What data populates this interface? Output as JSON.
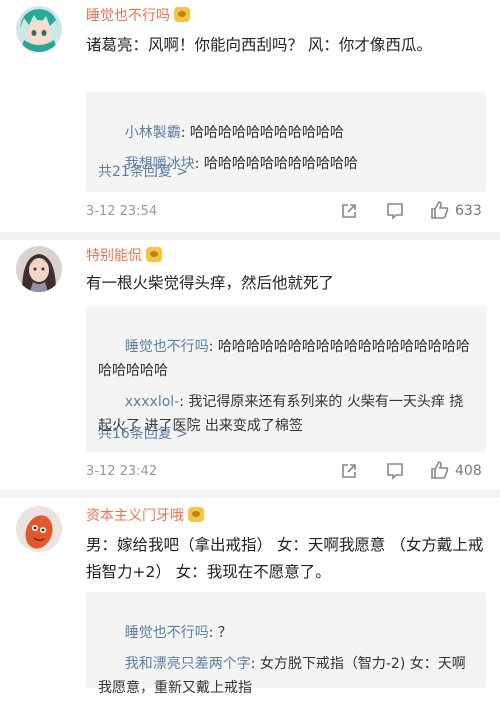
{
  "comments": [
    {
      "username": "睡觉也不行吗",
      "text": "诸葛亮：风啊！你能向西刮吗？ 风：你才像西瓜。",
      "replies": [
        {
          "name": "小林製霸",
          "text": "哈哈哈哈哈哈哈哈哈哈哈"
        },
        {
          "name": "我想嚼冰块",
          "text": "哈哈哈哈哈哈哈哈哈哈哈"
        }
      ],
      "more": "共21条回复 >",
      "time": "3-12 23:54",
      "likes": "633"
    },
    {
      "username": "特别能侃",
      "text": "有一根火柴觉得头痒，然后他就死了",
      "replies": [
        {
          "name": "睡觉也不行吗",
          "text": "哈哈哈哈哈哈哈哈哈哈哈哈哈哈哈哈哈哈哈哈哈哈哈"
        },
        {
          "name": "xxxxlol-",
          "text": "我记得原来还有系列来的 火柴有一天头痒 挠起火了 进了医院 出来变成了棉签"
        }
      ],
      "more": "共16条回复 >",
      "time": "3-12 23:42",
      "likes": "408"
    },
    {
      "username": "资本主义门牙哦",
      "text": "男：嫁给我吧（拿出戒指） 女：天啊我愿意 （女方戴上戒指智力+2） 女：我现在不愿意了。",
      "replies": [
        {
          "name": "睡觉也不行吗",
          "text": "？"
        },
        {
          "name": "我和漂亮只差两个字",
          "text": "女方脱下戒指（智力-2) 女：天啊我愿意，重新又戴上戒指"
        }
      ]
    }
  ],
  "colors": {
    "username": "#eb7350",
    "link": "#5e7ea3",
    "meta": "#999999",
    "reply_bg": "#f4f4f4"
  },
  "icons": [
    "share-icon",
    "comment-icon",
    "like-icon",
    "vip-badge-icon"
  ]
}
